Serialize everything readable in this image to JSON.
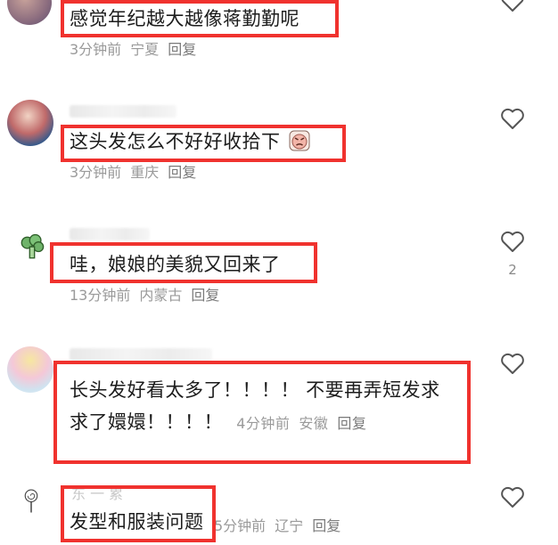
{
  "comments": [
    {
      "text": "感觉年纪越大越像蒋勤勤呢",
      "time": "3分钟前",
      "location": "宁夏",
      "reply": "回复",
      "likes": ""
    },
    {
      "text": "这头发怎么不好好收拾下",
      "emoji": "angry-face-emoji",
      "time": "3分钟前",
      "location": "重庆",
      "reply": "回复",
      "likes": ""
    },
    {
      "text": "哇，娘娘的美貌又回来了",
      "time": "13分钟前",
      "location": "内蒙古",
      "reply": "回复",
      "likes": "2"
    },
    {
      "text_line1": "长头发好看太多了！！！！ 不要再弄短发求",
      "text_line2": "求了嬛嬛！！！！",
      "time": "4分钟前",
      "location": "安徽",
      "reply": "回复",
      "likes": ""
    },
    {
      "text": "发型和服装问题",
      "time": "5分钟前",
      "location": "辽宁",
      "reply": "回复",
      "likes": "",
      "username_partial": "东 一 累"
    }
  ],
  "colors": {
    "highlight": "#f0322e",
    "meta": "#9a9a9a"
  },
  "icons": [
    "heart-outline-icon"
  ]
}
